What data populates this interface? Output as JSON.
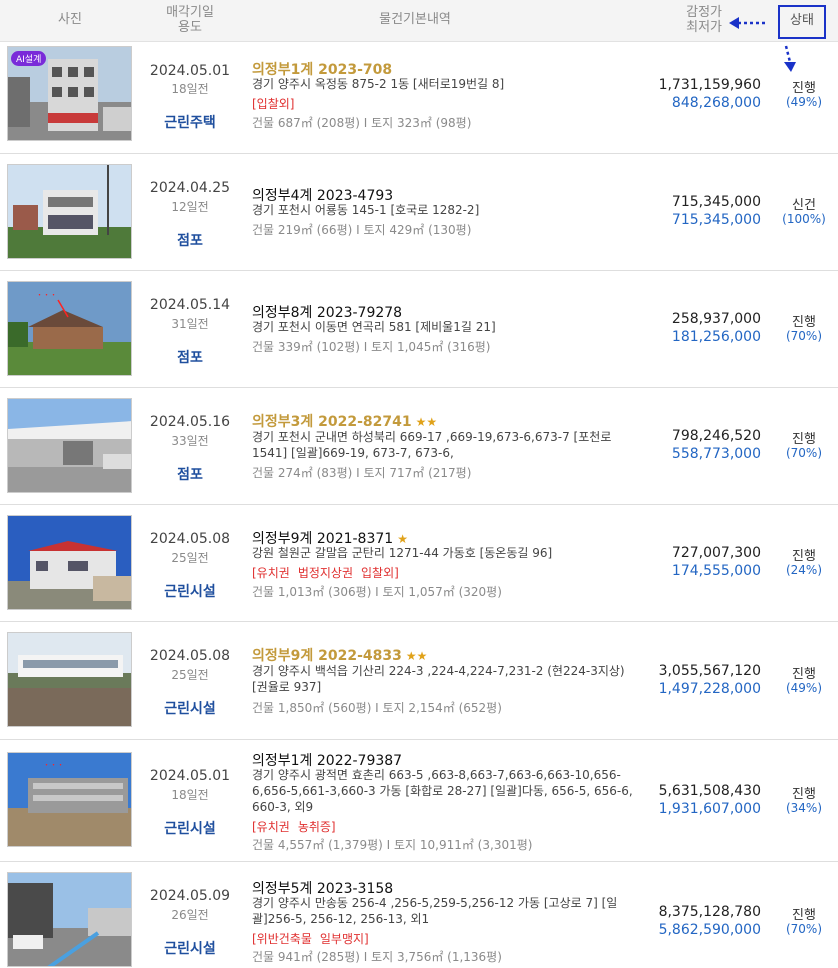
{
  "header": {
    "photo": "사진",
    "date_line1": "매각기일",
    "date_line2": "용도",
    "info": "물건기본내역",
    "price_line1": "감정가",
    "price_line2": "최저가",
    "status": "상태"
  },
  "colors": {
    "accent_blue": "#2366c3",
    "gold": "#c39a3c",
    "red_tag": "#e03030",
    "highlight_box": "#1a32c8"
  },
  "rows": [
    {
      "badge": "AI설계",
      "date": "2024.05.01",
      "days": "18일전",
      "usage": "근린주택",
      "case": "의정부1계 2023-708",
      "stars": "",
      "addr": "경기 양주시 옥정동 875-2 1동 [새터로19번길 8]",
      "tags": [
        "[입찰외]"
      ],
      "area": "건물 687㎡ (208평)  I  토지 323㎡ (98평)",
      "appraisal": "1,731,159,960",
      "min": "848,268,000",
      "status": "진행",
      "pct": "(49%)"
    },
    {
      "date": "2024.04.25",
      "days": "12일전",
      "usage": "점포",
      "case": "의정부4계 2023-4793",
      "stars": "",
      "addr": "경기 포천시 어룡동 145-1 [호국로 1282-2]",
      "tags": [],
      "area": "건물 219㎡ (66평)  I  토지 429㎡ (130평)",
      "appraisal": "715,345,000",
      "min": "715,345,000",
      "status": "신건",
      "pct": "(100%)"
    },
    {
      "date": "2024.05.14",
      "days": "31일전",
      "usage": "점포",
      "case": "의정부8계 2023-79278",
      "stars": "",
      "addr": "경기 포천시 이동면 연곡리 581 [제비울1길 21]",
      "tags": [],
      "area": "건물 339㎡ (102평)  I  토지 1,045㎡ (316평)",
      "appraisal": "258,937,000",
      "min": "181,256,000",
      "status": "진행",
      "pct": "(70%)"
    },
    {
      "date": "2024.05.16",
      "days": "33일전",
      "usage": "점포",
      "case": "의정부3계 2022-82741",
      "stars": "★★",
      "addr": "경기 포천시 군내면 하성북리 669-17 ,669-19,673-6,673-7 [포천로 1541] [일괄]669-19, 673-7, 673-6,",
      "tags": [],
      "area": "건물 274㎡ (83평)  I  토지 717㎡ (217평)",
      "appraisal": "798,246,520",
      "min": "558,773,000",
      "status": "진행",
      "pct": "(70%)"
    },
    {
      "date": "2024.05.08",
      "days": "25일전",
      "usage": "근린시설",
      "case": "의정부9계 2021-8371",
      "stars": "★",
      "addr": "강원 철원군 갈말읍 군탄리 1271-44 가동호 [동온동길 96]",
      "tags": [
        "[유치권",
        "법정지상권",
        "입찰외]"
      ],
      "area": "건물 1,013㎡ (306평)  I  토지 1,057㎡ (320평)",
      "appraisal": "727,007,300",
      "min": "174,555,000",
      "status": "진행",
      "pct": "(24%)"
    },
    {
      "date": "2024.05.08",
      "days": "25일전",
      "usage": "근린시설",
      "case": "의정부9계 2022-4833",
      "stars": "★★",
      "addr": "경기 양주시 백석읍 기산리 224-3 ,224-4,224-7,231-2 (현224-3지상) [권율로 937]",
      "tags": [],
      "area": "건물 1,850㎡ (560평)  I  토지 2,154㎡ (652평)",
      "appraisal": "3,055,567,120",
      "min": "1,497,228,000",
      "status": "진행",
      "pct": "(49%)"
    },
    {
      "date": "2024.05.01",
      "days": "18일전",
      "usage": "근린시설",
      "case": "의정부1계 2022-79387",
      "stars": "",
      "addr": "경기 양주시 광적면 효촌리 663-5 ,663-8,663-7,663-6,663-10,656-6,656-5,661-3,660-3 가동 [화합로 28-27] [일괄]다동, 656-5, 656-6, 660-3, 외9",
      "tags": [
        "[유치권",
        "농취증]"
      ],
      "area": "건물 4,557㎡ (1,379평)  I  토지 10,911㎡ (3,301평)",
      "appraisal": "5,631,508,430",
      "min": "1,931,607,000",
      "status": "진행",
      "pct": "(34%)"
    },
    {
      "date": "2024.05.09",
      "days": "26일전",
      "usage": "근린시설",
      "case": "의정부5계 2023-3158",
      "stars": "",
      "addr": "경기 양주시 만송동 256-4 ,256-5,259-5,256-12 가동 [고상로 7] [일괄]256-5, 256-12, 256-13, 외1",
      "tags": [
        "[위반건축물",
        "일부맹지]"
      ],
      "area": "건물 941㎡ (285평)  I  토지 3,756㎡ (1,136평)",
      "appraisal": "8,375,128,780",
      "min": "5,862,590,000",
      "status": "진행",
      "pct": "(70%)"
    }
  ]
}
